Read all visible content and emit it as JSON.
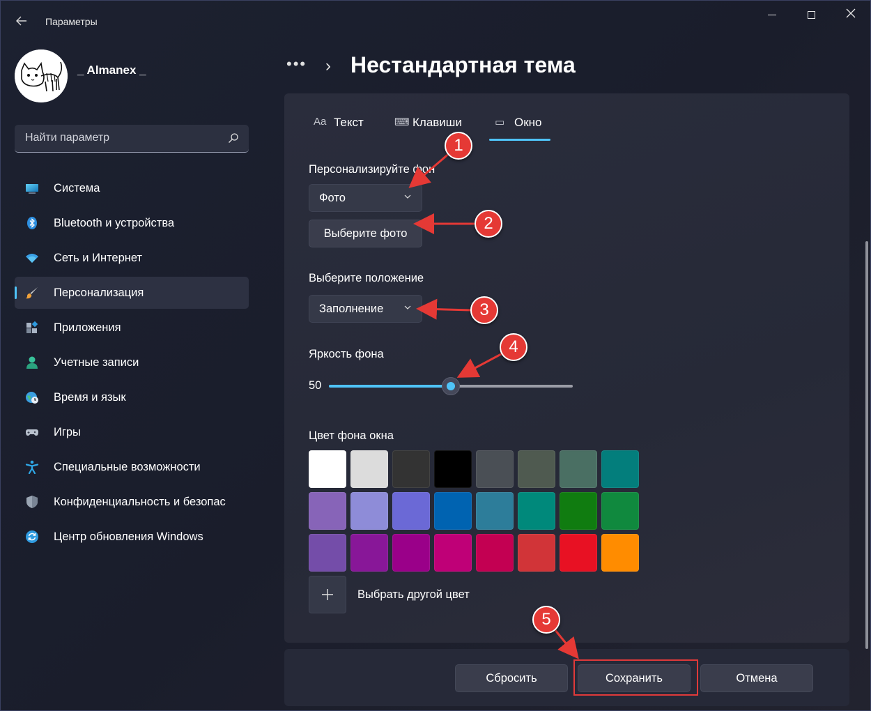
{
  "window": {
    "title": "Параметры",
    "back_icon": "back-arrow-icon",
    "minimize_icon": "minimize-icon",
    "maximize_icon": "maximize-icon",
    "close_icon": "close-icon"
  },
  "user": {
    "name": "_ Almanex _",
    "avatar_icon": "cat-avatar"
  },
  "search": {
    "placeholder": "Найти параметр",
    "icon": "search-icon"
  },
  "sidebar": {
    "items": [
      {
        "label": "Система",
        "icon": "monitor-icon",
        "active": false
      },
      {
        "label": "Bluetooth и устройства",
        "icon": "bluetooth-icon",
        "active": false
      },
      {
        "label": "Сеть и Интернет",
        "icon": "wifi-icon",
        "active": false
      },
      {
        "label": "Персонализация",
        "icon": "brush-icon",
        "active": true
      },
      {
        "label": "Приложения",
        "icon": "apps-icon",
        "active": false
      },
      {
        "label": "Учетные записи",
        "icon": "person-icon",
        "active": false
      },
      {
        "label": "Время и язык",
        "icon": "globe-clock-icon",
        "active": false
      },
      {
        "label": "Игры",
        "icon": "gamepad-icon",
        "active": false
      },
      {
        "label": "Специальные возможности",
        "icon": "accessibility-icon",
        "active": false
      },
      {
        "label": "Конфиденциальность и безопас",
        "icon": "shield-icon",
        "active": false
      },
      {
        "label": "Центр обновления Windows",
        "icon": "update-icon",
        "active": false
      }
    ]
  },
  "header": {
    "more": "•••",
    "separator": "›",
    "title": "Нестандартная тема"
  },
  "tabs": [
    {
      "label": "Текст",
      "icon_glyph": "Aa",
      "icon": "text-icon"
    },
    {
      "label": "Клавиши",
      "icon_glyph": "⌨",
      "icon": "keyboard-icon"
    },
    {
      "label": "Окно",
      "icon_glyph": "▭",
      "icon": "window-icon",
      "selected": true
    }
  ],
  "background": {
    "label": "Персонализируйте фон",
    "dropdown_value": "Фото",
    "choose_photo_button": "Выберите фото"
  },
  "position": {
    "label": "Выберите положение",
    "dropdown_value": "Заполнение"
  },
  "brightness": {
    "label": "Яркость фона",
    "value": "50",
    "fraction": 0.5
  },
  "window_color": {
    "label": "Цвет фона окна",
    "swatches": [
      "#ffffff",
      "#dcdcdc",
      "#333333",
      "#000000",
      "#4a4f55",
      "#4f5a50",
      "#4a6f63",
      "#037e7c",
      "#8764b8",
      "#8e8cd8",
      "#6b69d6",
      "#0063b1",
      "#2d7d9a",
      "#00897b",
      "#107c10",
      "#10893e",
      "#744da9",
      "#881798",
      "#9a0089",
      "#bf0077",
      "#c30052",
      "#d13438",
      "#e81123",
      "#ff8c00"
    ],
    "custom_label": "Выбрать другой цвет"
  },
  "footer": {
    "reset_button": "Сбросить",
    "save_button": "Сохранить",
    "cancel_button": "Отмена"
  },
  "annotations": [
    "1",
    "2",
    "3",
    "4",
    "5"
  ],
  "colors": {
    "accent": "#4fc3f7",
    "annotation_red": "#e53935"
  }
}
